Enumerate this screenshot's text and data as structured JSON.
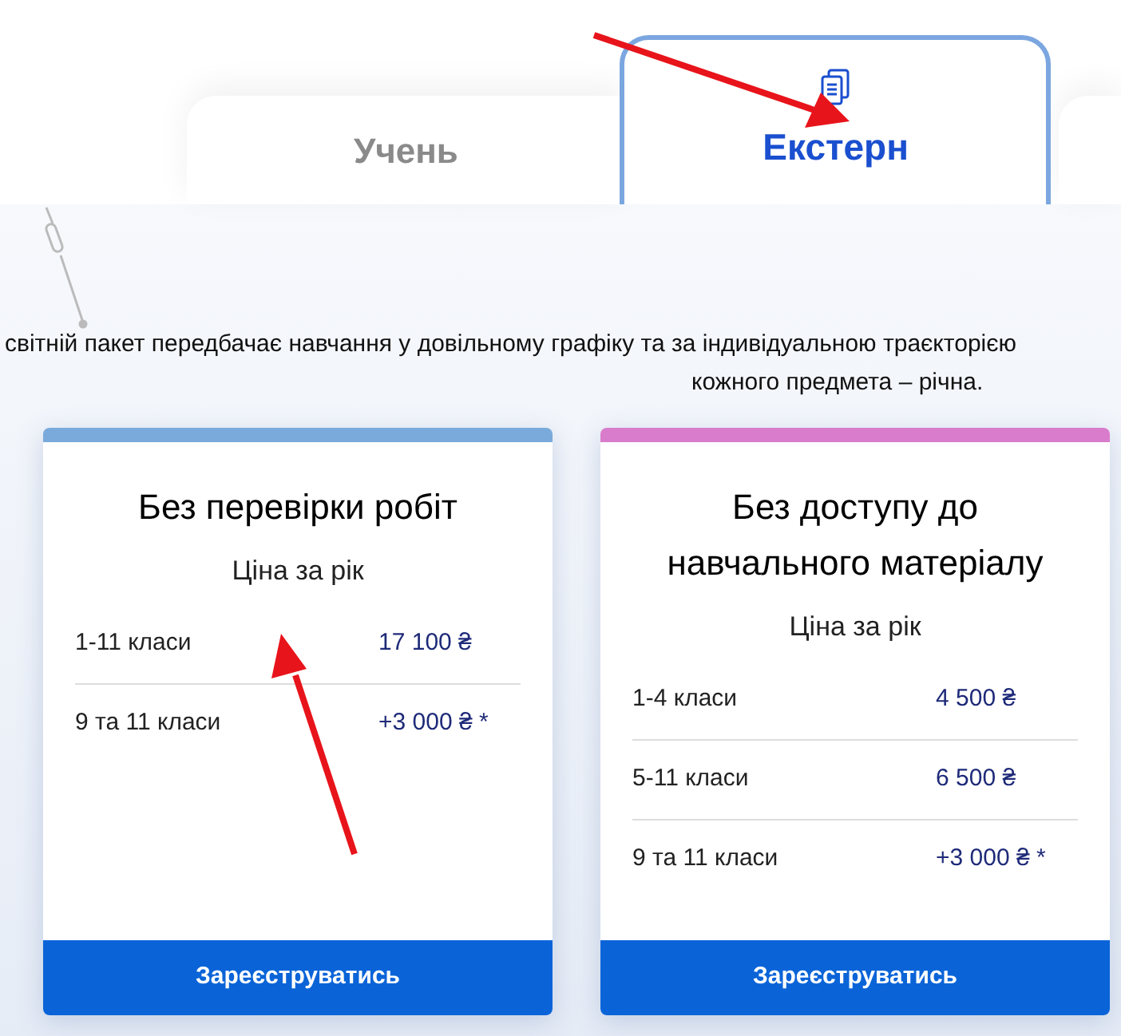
{
  "tabs": [
    {
      "label": "Учень",
      "selected": false
    },
    {
      "label": "Екстерн",
      "selected": true
    }
  ],
  "intro": [
    "світній пакет передбачає навчання у довільному графіку та за індивідуальною траєкторією",
    "кожного предмета – річна."
  ],
  "plans": [
    {
      "color": "#7aaadb",
      "title": "Без перевірки робіт",
      "subtitle": "Ціна за рік",
      "rows": [
        {
          "grades": "1-11 класи",
          "price": "17 100 ₴"
        },
        {
          "grades": "9 та 11 класи",
          "price": "+3 000 ₴ *"
        }
      ],
      "button": "Зареєструватись"
    },
    {
      "color": "#d97ccc",
      "title": "Без доступу до навчального матеріалу",
      "subtitle": "Ціна за рік",
      "rows": [
        {
          "grades": "1-4 класи",
          "price": "4 500 ₴"
        },
        {
          "grades": "5-11 класи",
          "price": "6 500 ₴"
        },
        {
          "grades": "9 та 11 класи",
          "price": "+3 000 ₴ *"
        }
      ],
      "button": "Зареєструватись"
    }
  ]
}
